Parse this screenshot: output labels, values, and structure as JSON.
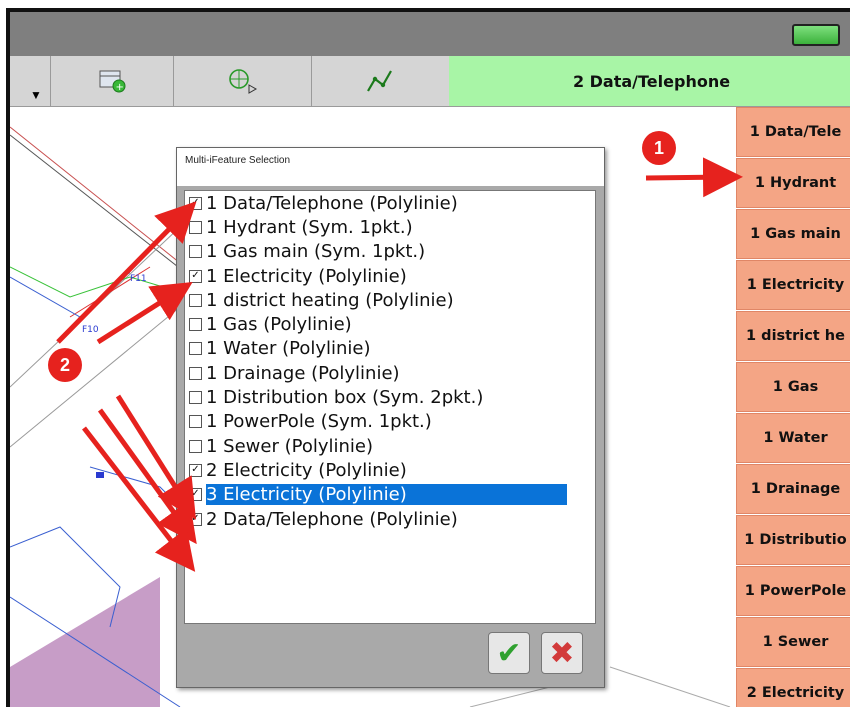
{
  "toolbar": {
    "active_tab": "2 Data/Telephone",
    "icons": [
      "dropdown-arrow-icon",
      "add-layer-icon",
      "target-icon",
      "polyline-icon"
    ]
  },
  "sidebar": {
    "items": [
      "1 Data/Tele",
      "1 Hydrant",
      "1 Gas main",
      "1 Electricity",
      "1 district he",
      "1 Gas",
      "1 Water",
      "1 Drainage",
      "1 Distributio",
      "1 PowerPole",
      "1 Sewer",
      "2 Electricity"
    ]
  },
  "dialog": {
    "title": "Multi-iFeature Selection",
    "items": [
      {
        "label": "1 Data/Telephone  (Polylinie)",
        "checked": true
      },
      {
        "label": "1 Hydrant  (Sym. 1pkt.)",
        "checked": false
      },
      {
        "label": "1 Gas main  (Sym. 1pkt.)",
        "checked": false
      },
      {
        "label": "1 Electricity  (Polylinie)",
        "checked": true
      },
      {
        "label": "1 district heating  (Polylinie)",
        "checked": false
      },
      {
        "label": "1 Gas  (Polylinie)",
        "checked": false
      },
      {
        "label": "1 Water  (Polylinie)",
        "checked": false
      },
      {
        "label": "1 Drainage  (Polylinie)",
        "checked": false
      },
      {
        "label": "1 Distribution box  (Sym. 2pkt.)",
        "checked": false
      },
      {
        "label": "1 PowerPole  (Sym. 1pkt.)",
        "checked": false
      },
      {
        "label": "1 Sewer  (Polylinie)",
        "checked": false
      },
      {
        "label": "2 Electricity  (Polylinie)",
        "checked": true
      },
      {
        "label": "3 Electricity  (Polylinie)",
        "checked": true,
        "selected": true
      },
      {
        "label": "2 Data/Telephone  (Polylinie)",
        "checked": true
      }
    ],
    "ok_icon": "checkmark-icon",
    "cancel_icon": "close-x-icon"
  },
  "annotations": {
    "marker_1": "1",
    "marker_2": "2"
  },
  "colors": {
    "accent_green": "#a8f5a6",
    "sidebar_orange": "#f4a585",
    "selection_blue": "#0a73d8",
    "marker_red": "#e6221e"
  }
}
